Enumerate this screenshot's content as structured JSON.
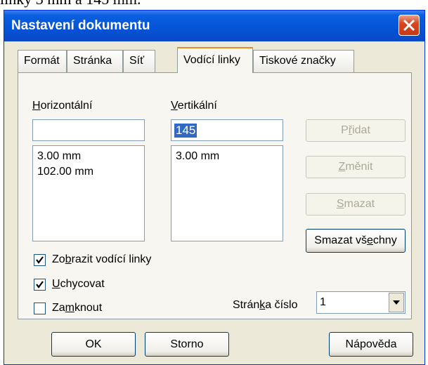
{
  "top_text": "linky 3 mm a 145 mm.",
  "window": {
    "title": "Nastavení dokumentu"
  },
  "tabs": [
    {
      "label": "Formát"
    },
    {
      "label": "Stránka"
    },
    {
      "label": "Síť"
    },
    {
      "label": "Vodící linky",
      "active": true
    },
    {
      "label": "Tiskové značky"
    }
  ],
  "horizontal": {
    "label_pre": "",
    "label_u": "H",
    "label_post": "orizontální",
    "input_value": "",
    "items": [
      "3.00 mm",
      "102.00 mm"
    ]
  },
  "vertical": {
    "label_pre": "",
    "label_u": "V",
    "label_post": "ertikální",
    "input_value": "145",
    "items": [
      "3.00 mm"
    ]
  },
  "buttons": {
    "add": {
      "pre": "P",
      "u": "ř",
      "post": "idat"
    },
    "change": {
      "pre": "",
      "u": "Z",
      "post": "měnit"
    },
    "delete": {
      "pre": "",
      "u": "S",
      "post": "mazat"
    },
    "delete_all": {
      "pre": "Smazat vš",
      "u": "e",
      "post": "chny"
    }
  },
  "checkboxes": [
    {
      "pre": "Zo",
      "u": "b",
      "post": "razit vodící linky",
      "checked": true
    },
    {
      "pre": "",
      "u": "U",
      "post": "chycovat",
      "checked": true
    },
    {
      "pre": "Za",
      "u": "m",
      "post": "knout",
      "checked": false
    }
  ],
  "page_number": {
    "pre": "Strán",
    "u": "k",
    "post": "a číslo",
    "value": "1"
  },
  "footer": {
    "ok": "OK",
    "cancel": "Storno",
    "help": "Nápověda"
  }
}
